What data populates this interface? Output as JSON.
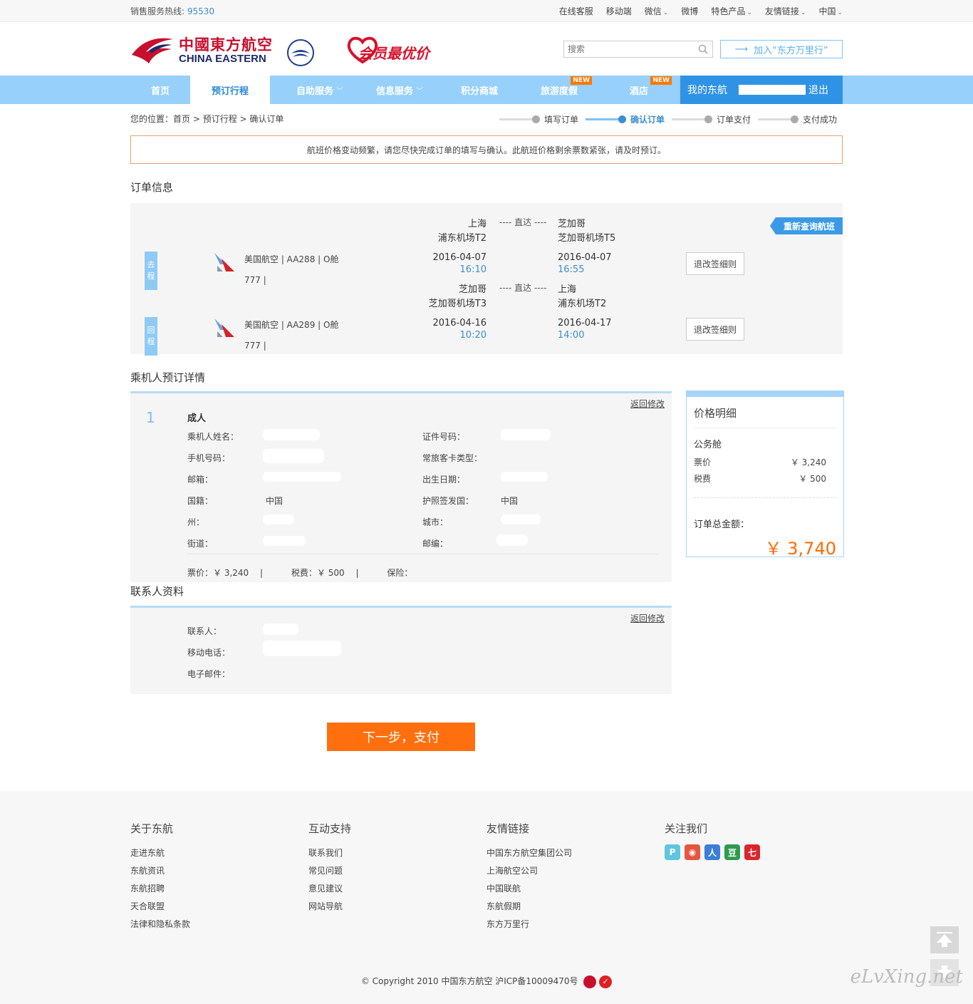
{
  "topbar": {
    "hotline_label": "销售服务热线:",
    "hotline_number": "95530",
    "links": [
      "在线客服",
      "移动端",
      "微信",
      "微博",
      "特色产品",
      "友情链接",
      "中国"
    ]
  },
  "header": {
    "logo_cn": "中國東方航空",
    "logo_en": "CHINA EASTERN",
    "skyteam": "SKYTEAM",
    "promo": "会员最优价",
    "search_placeholder": "搜索",
    "join": "加入“东方万里行”"
  },
  "nav": {
    "items": [
      "首页",
      "预订行程",
      "自助服务",
      "信息服务",
      "积分商城",
      "旅游度假",
      "酒店"
    ],
    "new_badge": "NEW",
    "my": "我的东航",
    "logout": "退出"
  },
  "crumb": {
    "label": "您的位置：",
    "path": "首页 > 预订行程 > 确认订单"
  },
  "steps": [
    "填写订单",
    "确认订单",
    "订单支付",
    "支付成功"
  ],
  "warning": "航班价格变动频繁，请您尽快完成订单的填写与确认。此航班价格剩余票数紧张，请及时预订。",
  "order": {
    "title": "订单信息",
    "requery": "重新查询航班",
    "rules": "退改签细则",
    "direct": "---- 直达 ----",
    "outbound": {
      "tag1": "去",
      "tag2": "程",
      "airline": "美国航空 | AA288 | O舱",
      "aircraft": "777 |",
      "from_city": "上海",
      "from_airport": "浦东机场T2",
      "from_date": "2016-04-07",
      "from_time": "16:10",
      "to_city": "芝加哥",
      "to_airport": "芝加哥机场T5",
      "to_date": "2016-04-07",
      "to_time": "16:55"
    },
    "inbound": {
      "tag1": "回",
      "tag2": "程",
      "airline": "美国航空 | AA289 | O舱",
      "aircraft": "777 |",
      "from_city": "芝加哥",
      "from_airport": "芝加哥机场T3",
      "from_date": "2016-04-16",
      "from_time": "10:20",
      "to_city": "上海",
      "to_airport": "浦东机场T2",
      "to_date": "2016-04-17",
      "to_time": "14:00"
    }
  },
  "passenger": {
    "title": "乘机人预订详情",
    "edit": "返回修改",
    "index": "1",
    "type": "成人",
    "labels": {
      "name": "乘机人姓名：",
      "id": "证件号码：",
      "phone": "手机号码：",
      "card": "常旅客卡类型：",
      "email": "邮箱：",
      "birth": "出生日期：",
      "nation": "国籍：",
      "passport": "护照签发国：",
      "state": "州：",
      "city": "城市：",
      "street": "街道：",
      "zip": "邮编："
    },
    "values": {
      "nation": "中国",
      "passport": "中国"
    },
    "summary": {
      "ticket": "票价：￥ 3,240",
      "sep1": "|",
      "tax": "税费：￥ 500",
      "sep2": "|",
      "insurance": "保险："
    }
  },
  "price": {
    "title": "价格明细",
    "cabin": "公务舱",
    "ticket_label": "票价",
    "ticket_value": "￥ 3,240",
    "tax_label": "税费",
    "tax_value": "￥ 500",
    "total_label": "订单总金额：",
    "total_value": "￥ 3,740"
  },
  "contact": {
    "title": "联系人资料",
    "edit": "返回修改",
    "labels": {
      "name": "联系人：",
      "mobile": "移动电话：",
      "email": "电子邮件："
    }
  },
  "next_button": "下一步，支付",
  "footer": {
    "cols": [
      {
        "title": "关于东航",
        "items": [
          "走进东航",
          "东航资讯",
          "东航招聘",
          "天合联盟",
          "法律和隐私条款"
        ]
      },
      {
        "title": "互动支持",
        "items": [
          "联系我们",
          "常见问题",
          "意见建议",
          "网站导航"
        ]
      },
      {
        "title": "友情链接",
        "items": [
          "中国东方航空集团公司",
          "上海航空公司",
          "中国联航",
          "东航假期",
          "东方万里行"
        ]
      },
      {
        "title": "关注我们",
        "items": []
      }
    ],
    "copyright": "© Copyright 2010 中国东方航空 沪ICP备10009470号",
    "watermark": "eLvXing.net"
  },
  "colors": {
    "nav": "#96d0fb",
    "accent": "#3a8fd0",
    "orange": "#ff6f0e",
    "brand_red": "#c8102e"
  }
}
